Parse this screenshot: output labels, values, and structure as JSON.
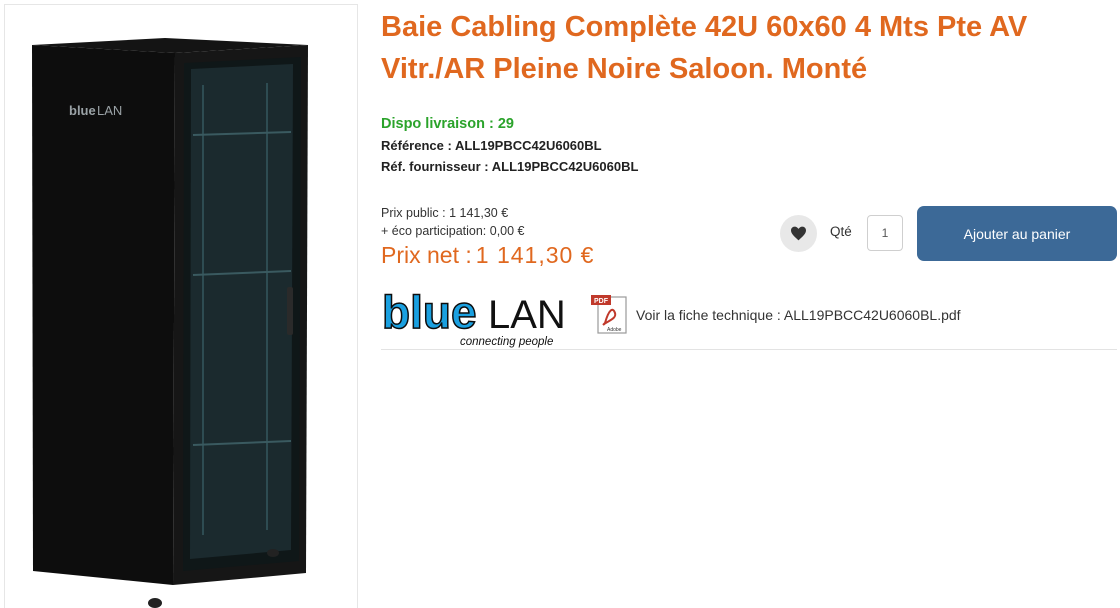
{
  "product": {
    "title": "Baie Cabling Complète 42U 60x60 4 Mts Pte AV Vitr./AR Pleine Noire Saloon. Monté",
    "image_brand": "blueLAN"
  },
  "availability": {
    "label": "Dispo livraison : 29"
  },
  "references": {
    "reference": "Référence : ALL19PBCC42U6060BL",
    "supplier_reference": "Réf. fournisseur : ALL19PBCC42U6060BL"
  },
  "pricing": {
    "public_price": "Prix public : 1 141,30 €",
    "eco_participation": "+ éco participation: 0,00 €",
    "net_label": "Prix net :",
    "net_amount": "1 141,30 €"
  },
  "cart": {
    "favorite_icon": "heart-icon",
    "qty_label": "Qté",
    "qty_value": "1",
    "add_button": "Ajouter au panier"
  },
  "brand": {
    "logo_main": "blue",
    "logo_secondary": "LAN",
    "tagline": "connecting people"
  },
  "document": {
    "pdf_badge": "PDF",
    "pdf_vendor": "Adobe",
    "link_text": "Voir la fiche technique : ALL19PBCC42U6060BL.pdf"
  },
  "colors": {
    "title_orange": "#e0681f",
    "availability_green": "#2ba32b",
    "button_blue": "#3c6997",
    "brand_blue": "#1aa0e0"
  }
}
